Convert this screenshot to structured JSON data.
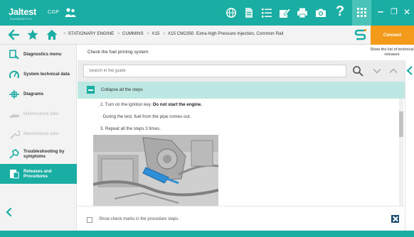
{
  "app": {
    "logo": "Jaltest",
    "logo_sub": "DIAGNOSTICS",
    "product": "CGP",
    "help": "?"
  },
  "window": {
    "minimize": "–",
    "restore": "❐",
    "close": "✕"
  },
  "breadcrumb": {
    "items": [
      "STATIONARY ENGINE",
      "CUMMINS",
      "X15",
      "X15 CM2350. Extra-high Pressure Injection, Common Rail"
    ]
  },
  "connect": {
    "label": "Connect"
  },
  "sidebar": {
    "items": [
      {
        "label": "Diagnostics menu",
        "icon": "diagnostics-icon",
        "state": "normal"
      },
      {
        "label": "System technical data",
        "icon": "technical-data-icon",
        "state": "normal"
      },
      {
        "label": "Diagrams",
        "icon": "diagrams-icon",
        "state": "normal"
      },
      {
        "label": "Maintenance data",
        "icon": "maintenance-icon",
        "state": "disabled"
      },
      {
        "label": "Maintenance data",
        "icon": "wrench-icon",
        "state": "disabled"
      },
      {
        "label": "Troubleshooting by symptoms",
        "icon": "troubleshooting-icon",
        "state": "normal"
      },
      {
        "label": "Releases and Procedures",
        "icon": "procedures-icon",
        "state": "active"
      }
    ]
  },
  "main": {
    "title": "Check the fuel priming system",
    "right_note": "Show the list of technical releases",
    "search": {
      "placeholder": "Search in the guide"
    },
    "collapse_label": "Collapse all the steps",
    "steps": {
      "step2_prefix": "2. Turn on the ignition key. ",
      "step2_bold": "Do not start the engine.",
      "note": "· During the test, fuel from the pipe comes out.",
      "step3": "3. Repeat all the steps 3 times."
    },
    "footer": {
      "checkbox_label": "Show check marks in the procedure steps."
    }
  },
  "colors": {
    "accent": "#1aada3",
    "connect": "#f39a1b",
    "highlight": "#bde7e2",
    "dark_button": "#1f4f73"
  }
}
